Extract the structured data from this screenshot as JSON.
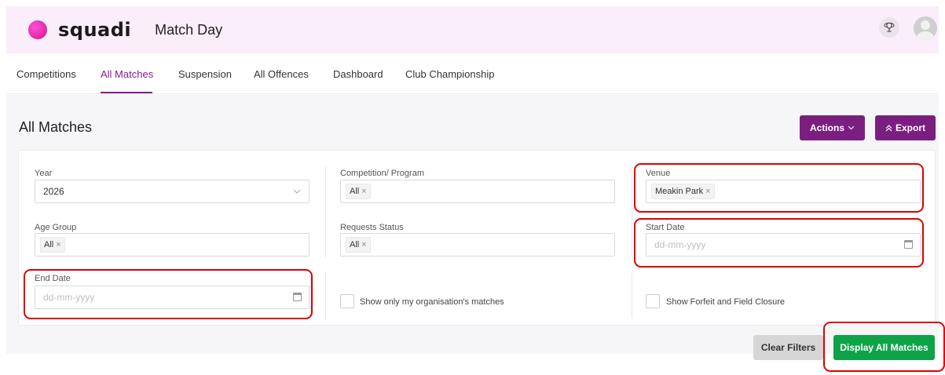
{
  "header": {
    "logo_text": "squadi",
    "app_title": "Match Day",
    "trophy_icon": "trophy-icon",
    "avatar_icon": "user-avatar-icon"
  },
  "nav": {
    "tabs": [
      {
        "label": "Competitions",
        "active": false
      },
      {
        "label": "All Matches",
        "active": true
      },
      {
        "label": "Suspension",
        "active": false
      },
      {
        "label": "All Offences",
        "active": false
      },
      {
        "label": "Dashboard",
        "active": false
      },
      {
        "label": "Club Championship",
        "active": false
      }
    ]
  },
  "page": {
    "title": "All Matches",
    "actions_label": "Actions",
    "export_label": "Export"
  },
  "filters": {
    "year": {
      "label": "Year",
      "value": "2026"
    },
    "competition": {
      "label": "Competition/ Program",
      "tag": "All"
    },
    "venue": {
      "label": "Venue",
      "tag": "Meakin Park"
    },
    "age_group": {
      "label": "Age Group",
      "tag": "All"
    },
    "requests_status": {
      "label": "Requests Status",
      "tag": "All"
    },
    "start_date": {
      "label": "Start Date",
      "placeholder": "dd-mm-yyyy"
    },
    "end_date": {
      "label": "End Date",
      "placeholder": "dd-mm-yyyy"
    },
    "own_org_checkbox": {
      "label": "Show only my organisation's matches",
      "checked": false
    },
    "forfeit_checkbox": {
      "label": "Show Forfeit and Field Closure",
      "checked": false
    },
    "tag_remove_glyph": "×"
  },
  "buttons": {
    "clear_filters": "Clear Filters",
    "display_all_matches": "Display All Matches"
  },
  "colors": {
    "brand_purple": "#7a1f80",
    "active_tab": "#8a1b8d",
    "display_green": "#0fa348",
    "highlight_red": "#e00000",
    "header_bg": "#f9eef9"
  }
}
